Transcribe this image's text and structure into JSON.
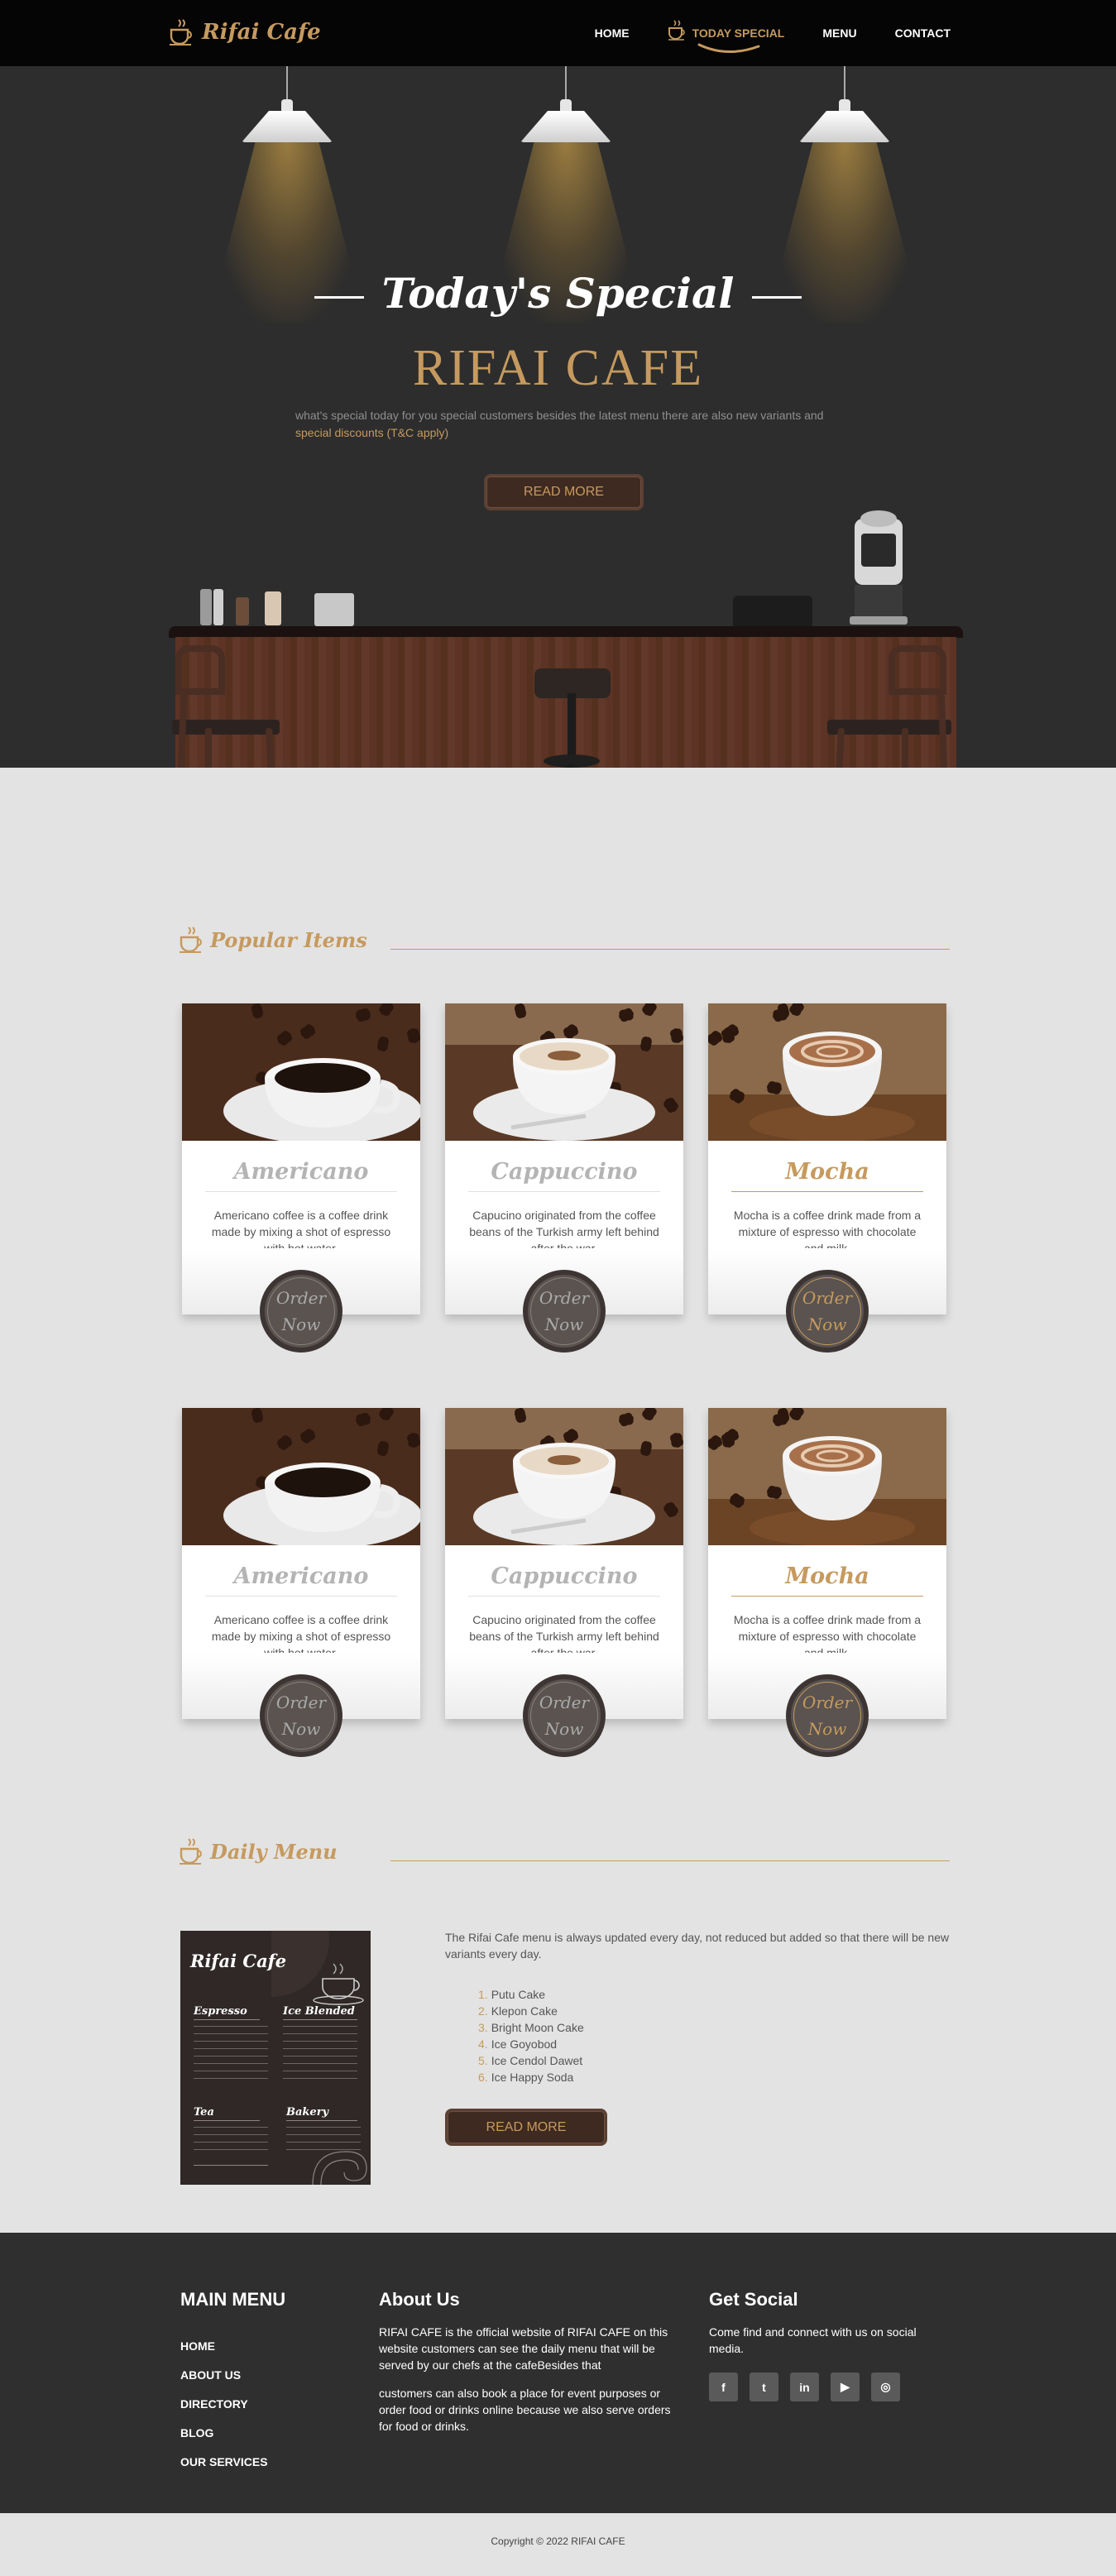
{
  "brand": {
    "logo_text": "Rifai Cafe"
  },
  "nav": {
    "items": [
      {
        "label": "HOME"
      },
      {
        "label": "TODAY SPECIAL"
      },
      {
        "label": "MENU"
      },
      {
        "label": "CONTACT"
      }
    ],
    "active_index": 1
  },
  "hero": {
    "title": "Today's Special",
    "brand": "RIFAI CAFE",
    "desc_prefix": "what's special today for you special customers besides the latest menu there are also new variants and",
    "desc_highlight": "special discounts (T&C apply)",
    "button": "READ MORE"
  },
  "popular": {
    "title": "Popular Items",
    "cards": [
      {
        "name": "Americano",
        "desc": "Americano coffee is a coffee drink made by mixing a shot of espresso with hot water.",
        "order_line1": "Order",
        "order_line2": "Now",
        "highlight": false,
        "photo": "americano-photo"
      },
      {
        "name": "Cappuccino",
        "desc": "Capucino originated from the coffee beans of the Turkish army left behind after the war.",
        "order_line1": "Order",
        "order_line2": "Now",
        "highlight": false,
        "photo": "cappuccino-photo"
      },
      {
        "name": "Mocha",
        "desc": "Mocha is a coffee drink made from a mixture of espresso with chocolate and milk.",
        "order_line1": "Order",
        "order_line2": "Now",
        "highlight": true,
        "photo": "mocha-photo"
      },
      {
        "name": "Americano",
        "desc": "Americano coffee is a coffee drink made by mixing a shot of espresso with hot water.",
        "order_line1": "Order",
        "order_line2": "Now",
        "highlight": false,
        "photo": "americano-photo"
      },
      {
        "name": "Cappuccino",
        "desc": "Capucino originated from the coffee beans of the Turkish army left behind after the war.",
        "order_line1": "Order",
        "order_line2": "Now",
        "highlight": false,
        "photo": "cappuccino-photo"
      },
      {
        "name": "Mocha",
        "desc": "Mocha is a coffee drink made from a mixture of espresso with chocolate and milk.",
        "order_line1": "Order",
        "order_line2": "Now",
        "highlight": true,
        "photo": "mocha-photo"
      }
    ]
  },
  "daily": {
    "title": "Daily Menu",
    "board": {
      "title": "Rifai Cafe",
      "sections": [
        "Espresso",
        "Ice Blended",
        "Tea",
        "Bakery"
      ]
    },
    "text": "The Rifai Cafe menu is always updated every day, not reduced but added so that there will be new variants every day.",
    "list": [
      {
        "num": "1.",
        "label": "Putu Cake"
      },
      {
        "num": "2.",
        "label": "Klepon Cake"
      },
      {
        "num": "3.",
        "label": "Bright Moon Cake"
      },
      {
        "num": "4.",
        "label": "Ice Goyobod"
      },
      {
        "num": "5.",
        "label": "Ice Cendol Dawet"
      },
      {
        "num": "6.",
        "label": "Ice Happy Soda"
      }
    ],
    "button": "READ MORE"
  },
  "footer": {
    "main_menu": {
      "title": "MAIN MENU",
      "links": [
        "HOME",
        "ABOUT US",
        "DIRECTORY",
        "BLOG",
        "OUR SERVICES"
      ]
    },
    "about": {
      "title": "About Us",
      "p1": "RIFAI CAFE is the official website of RIFAI CAFE on this website customers can see the daily menu that will be served by our chefs at the cafeBesides that",
      "p2": "customers can also book a place for event purposes or order food or drinks online because we also serve orders for food or drinks."
    },
    "social": {
      "title": "Get Social",
      "text": "Come find and connect with us on social media.",
      "icons": [
        {
          "name": "facebook-icon",
          "glyph": "f"
        },
        {
          "name": "twitter-icon",
          "glyph": "t"
        },
        {
          "name": "linkedin-icon",
          "glyph": "in"
        },
        {
          "name": "youtube-icon",
          "glyph": "▶"
        },
        {
          "name": "instagram-icon",
          "glyph": "◎"
        }
      ]
    }
  },
  "copyright": "Copyright © 2022 RIFAI CAFE",
  "colors": {
    "accent": "#c69a5e",
    "dark": "#2d2d2d",
    "nav_bg": "#050505",
    "page_bg": "#e3e3e3"
  }
}
